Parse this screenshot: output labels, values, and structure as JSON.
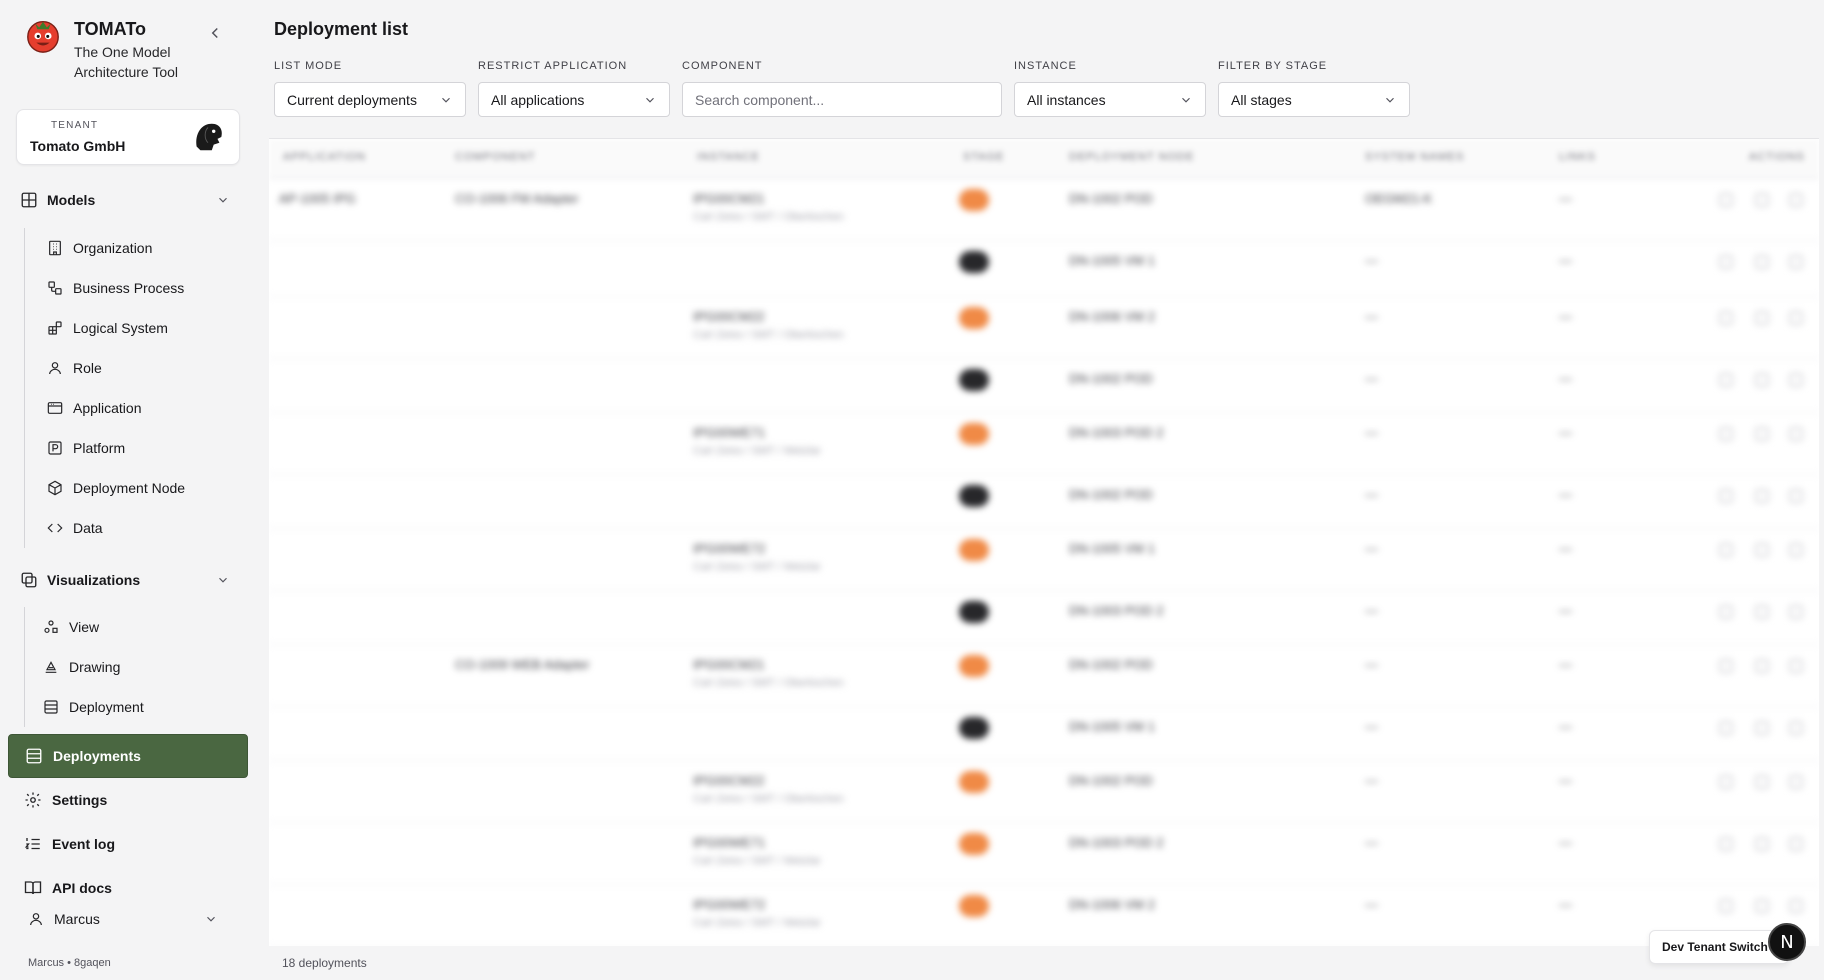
{
  "app": {
    "name": "TOMATo",
    "subtitle_line1": "The One Model",
    "subtitle_line2": "Architecture Tool"
  },
  "tenant": {
    "label": "TENANT",
    "name": "Tomato GmbH"
  },
  "nav": {
    "models": {
      "label": "Models",
      "items": [
        {
          "label": "Organization",
          "icon": "building-icon"
        },
        {
          "label": "Business Process",
          "icon": "workflow-icon"
        },
        {
          "label": "Logical System",
          "icon": "blocks-icon"
        },
        {
          "label": "Role",
          "icon": "user-icon"
        },
        {
          "label": "Application",
          "icon": "window-icon"
        },
        {
          "label": "Platform",
          "icon": "platform-icon"
        },
        {
          "label": "Deployment Node",
          "icon": "box-icon"
        },
        {
          "label": "Data",
          "icon": "code-icon"
        }
      ]
    },
    "visualizations": {
      "label": "Visualizations",
      "items": [
        {
          "label": "View",
          "icon": "shapes-icon"
        },
        {
          "label": "Drawing",
          "icon": "drafting-icon"
        },
        {
          "label": "Deployment",
          "icon": "list-icon"
        }
      ]
    },
    "deployments": "Deployments",
    "settings": "Settings",
    "event_log": "Event log",
    "api_docs": "API docs"
  },
  "user": {
    "name": "Marcus",
    "meta": "Marcus • 8gaqen"
  },
  "page": {
    "title": "Deployment list"
  },
  "filters": {
    "list_mode": {
      "label": "LIST MODE",
      "value": "Current deployments"
    },
    "restrict_application": {
      "label": "RESTRICT APPLICATION",
      "value": "All applications"
    },
    "component": {
      "label": "COMPONENT",
      "placeholder": "Search component..."
    },
    "instance": {
      "label": "INSTANCE",
      "value": "All instances"
    },
    "stage": {
      "label": "FILTER BY STAGE",
      "value": "All stages"
    }
  },
  "table": {
    "columns": [
      "APPLICATION",
      "COMPONENT",
      "INSTANCE",
      "STAGE",
      "DEPLOYMENT NODE",
      "SYSTEM NAMES",
      "LINKS",
      "ACTIONS"
    ],
    "rows": [
      {
        "application": "AP-1005 IPG",
        "component": "CO-1006 FM Adapter",
        "instance": "IPG00CM21",
        "location": "Carl Zeiss / SMT / Oberkochen",
        "stage": "orange",
        "node": "DN-1002 POD",
        "system": "OEGM21-K",
        "links": "—"
      },
      {
        "application": "",
        "component": "",
        "instance": "",
        "location": "",
        "stage": "dark",
        "node": "DN-1005 VM 1",
        "system": "—",
        "links": "—"
      },
      {
        "application": "",
        "component": "",
        "instance": "IPG00CM22",
        "location": "Carl Zeiss / SMT / Oberkochen",
        "stage": "orange",
        "node": "DN-1006 VM 2",
        "system": "—",
        "links": "—"
      },
      {
        "application": "",
        "component": "",
        "instance": "",
        "location": "",
        "stage": "dark",
        "node": "DN-1002 POD",
        "system": "—",
        "links": "—"
      },
      {
        "application": "",
        "component": "",
        "instance": "IPG00WE71",
        "location": "Carl Zeiss / SMT / Wetzlar",
        "stage": "orange",
        "node": "DN-1003 POD 2",
        "system": "—",
        "links": "—"
      },
      {
        "application": "",
        "component": "",
        "instance": "",
        "location": "",
        "stage": "dark",
        "node": "DN-1002 POD",
        "system": "—",
        "links": "—"
      },
      {
        "application": "",
        "component": "",
        "instance": "IPG00WE72",
        "location": "Carl Zeiss / SMT / Wetzlar",
        "stage": "orange",
        "node": "DN-1005 VM 1",
        "system": "—",
        "links": "—"
      },
      {
        "application": "",
        "component": "",
        "instance": "",
        "location": "",
        "stage": "dark",
        "node": "DN-1003 POD 2",
        "system": "—",
        "links": "—"
      },
      {
        "application": "",
        "component": "CO-1009 WEB Adapter",
        "instance": "IPG00CM21",
        "location": "Carl Zeiss / SMT / Oberkochen",
        "stage": "orange",
        "node": "DN-1002 POD",
        "system": "—",
        "links": "—"
      },
      {
        "application": "",
        "component": "",
        "instance": "",
        "location": "",
        "stage": "dark",
        "node": "DN-1005 VM 1",
        "system": "—",
        "links": "—"
      },
      {
        "application": "",
        "component": "",
        "instance": "IPG00CM22",
        "location": "Carl Zeiss / SMT / Oberkochen",
        "stage": "orange",
        "node": "DN-1002 POD",
        "system": "—",
        "links": "—"
      },
      {
        "application": "",
        "component": "",
        "instance": "IPG00WE71",
        "location": "Carl Zeiss / SMT / Wetzlar",
        "stage": "orange",
        "node": "DN-1003 POD 2",
        "system": "—",
        "links": "—"
      },
      {
        "application": "",
        "component": "",
        "instance": "IPG00WE72",
        "location": "Carl Zeiss / SMT / Wetzlar",
        "stage": "orange",
        "node": "DN-1006 VM 2",
        "system": "—",
        "links": "—"
      }
    ]
  },
  "footer": {
    "count": "18 deployments"
  },
  "dev_tenant_switch": "Dev Tenant Switch",
  "dev_badge": "N",
  "colors": {
    "accent": "#4a6741",
    "stage_orange": "#f08a46",
    "stage_dark": "#27272a"
  }
}
